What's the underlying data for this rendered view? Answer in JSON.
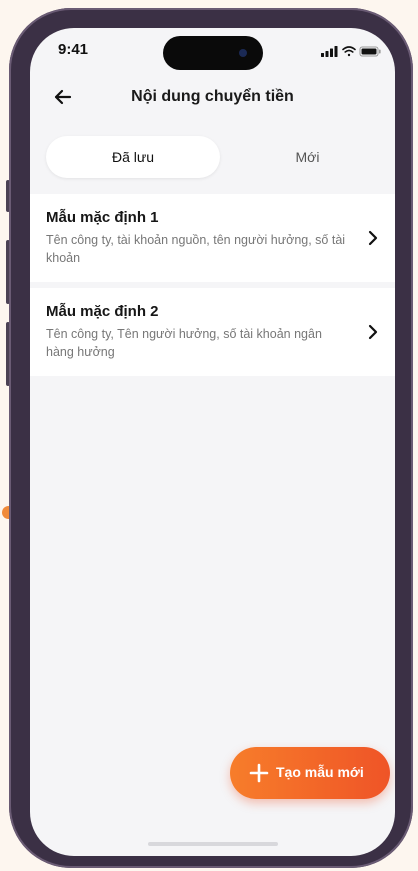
{
  "status_bar": {
    "time": "9:41"
  },
  "header": {
    "title": "Nội dung chuyển tiền"
  },
  "tabs": [
    {
      "label": "Đã lưu",
      "active": true
    },
    {
      "label": "Mới",
      "active": false
    }
  ],
  "templates": [
    {
      "title": "Mẫu mặc định 1",
      "description": "Tên công ty, tài khoản nguồn, tên người hưởng, số tài khoản"
    },
    {
      "title": "Mẫu mặc định 2",
      "description": "Tên công ty, Tên người hưởng, số tài khoản ngân hàng hưởng"
    }
  ],
  "fab": {
    "label": "Tạo mẫu mới"
  },
  "colors": {
    "accent": "#f26a2a",
    "background": "#f5f5f7",
    "frame": "#3b3045"
  }
}
